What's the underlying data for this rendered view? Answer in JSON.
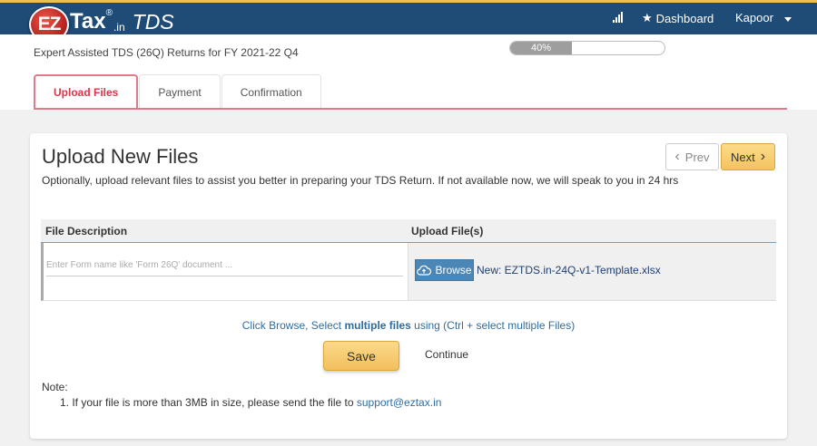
{
  "header": {
    "logo_ez": "EZ",
    "logo_tax": "Tax",
    "logo_reg": "®",
    "logo_in": ".in",
    "logo_tds": "TDS",
    "nav_dashboard": "Dashboard",
    "nav_user": "Kapoor"
  },
  "subheader": {
    "title": "Expert Assisted TDS (26Q) Returns for FY 2021-22 Q4",
    "progress_label": "40%",
    "progress_value": 0.4
  },
  "tabs": [
    {
      "label": "Upload Files",
      "active": true
    },
    {
      "label": "Payment",
      "active": false
    },
    {
      "label": "Confirmation",
      "active": false
    }
  ],
  "card": {
    "title": "Upload New Files",
    "description": "Optionally, upload relevant files to assist you better in preparing your TDS Return. If not available now, we will speak to you in 24 hrs",
    "prev_label": "Prev",
    "next_label": "Next"
  },
  "table": {
    "col_description": "File Description",
    "col_upload": "Upload File(s)",
    "row": {
      "description_placeholder": "Enter Form name like 'Form 26Q' document ...",
      "browse_label": "Browse",
      "file_name": "New: EZTDS.in-24Q-v1-Template.xlsx"
    }
  },
  "hint": {
    "part1": "Click Browse, Select ",
    "bold": "multiple files",
    "part2": " using (Ctrl + select multiple Files)"
  },
  "actions": {
    "save_label": "Save",
    "continue_label": "Continue"
  },
  "note": {
    "title": "Note:",
    "item_text": "1. If your file is more than 3MB in size, please send the file to ",
    "item_email": "support@eztax.in"
  },
  "colors": {
    "header_bg": "#1f4b77",
    "accent_red": "#d9354a",
    "button_gold": "#f3c35e",
    "link_blue": "#2e6da4"
  }
}
